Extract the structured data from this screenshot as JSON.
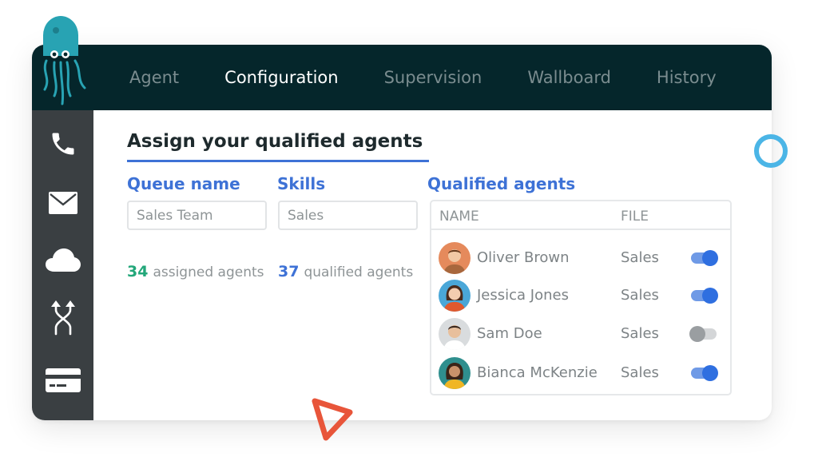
{
  "nav": {
    "tabs": [
      {
        "label": "Agent",
        "active": false
      },
      {
        "label": "Configuration",
        "active": true
      },
      {
        "label": "Supervision",
        "active": false
      },
      {
        "label": "Wallboard",
        "active": false
      },
      {
        "label": "History",
        "active": false
      }
    ]
  },
  "sidebar": {
    "items": [
      {
        "icon": "phone-icon"
      },
      {
        "icon": "mail-icon"
      },
      {
        "icon": "cloud-icon"
      },
      {
        "icon": "routing-arrows-icon"
      },
      {
        "icon": "card-icon"
      }
    ]
  },
  "main": {
    "heading": "Assign your qualified agents",
    "queue": {
      "label": "Queue name",
      "value": "Sales Team"
    },
    "skills": {
      "label": "Skills",
      "value": "Sales"
    },
    "assigned": {
      "count": "34",
      "text": "assigned agents"
    },
    "qualified": {
      "count": "37",
      "text": "qualified agents"
    },
    "agents_label": "Qualified agents"
  },
  "agents_table": {
    "columns": [
      "NAME",
      "FILE"
    ],
    "rows": [
      {
        "name": "Oliver Brown",
        "file": "Sales",
        "enabled": true
      },
      {
        "name": "Jessica Jones",
        "file": "Sales",
        "enabled": true
      },
      {
        "name": "Sam Doe",
        "file": "Sales",
        "enabled": false
      },
      {
        "name": "Bianca McKenzie",
        "file": "Sales",
        "enabled": true
      }
    ]
  },
  "colors": {
    "topbar": "#05262b",
    "sidebar": "#3a3f42",
    "accent_blue": "#3e72d6",
    "accent_green": "#23a77a",
    "logo_teal": "#28a3b3",
    "ring": "#4bb5e6",
    "triangle": "#e8553a"
  }
}
